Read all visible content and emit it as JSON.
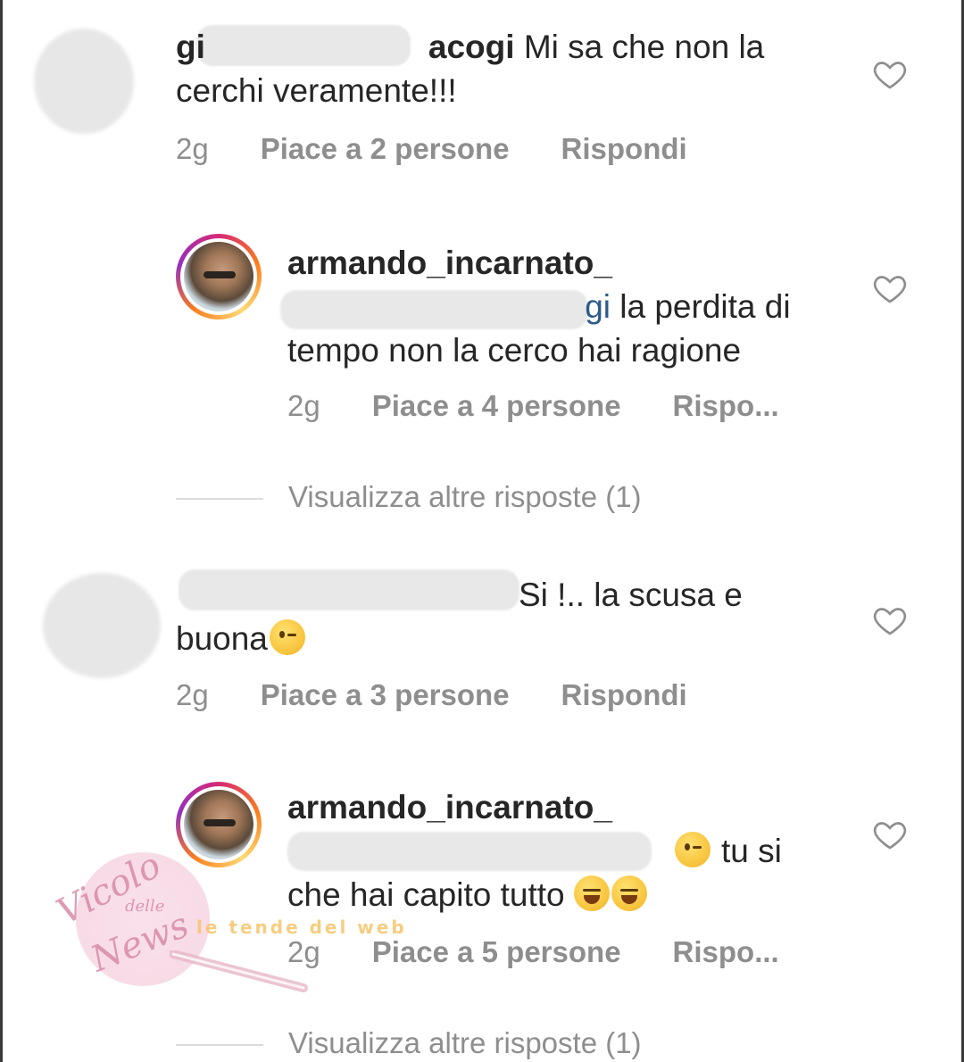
{
  "comments": [
    {
      "username": "gi",
      "username_tail": "acogi",
      "text": "Mi sa che non la cerchi veramente!!!",
      "time": "2g",
      "likes": "Piace a 2 persone",
      "reply": "Rispondi"
    },
    {
      "username": "armando_incarnato_",
      "mention_tail": "gi",
      "text": "la perdita di tempo non la cerco hai ragione",
      "time": "2g",
      "likes": "Piace a 4 persone",
      "reply": "Rispo..."
    },
    {
      "username_tail": "",
      "text_line1": "Si !.. la scusa e",
      "text_line2": "buona",
      "time": "2g",
      "likes": "Piace a 3 persone",
      "reply": "Rispondi"
    },
    {
      "username": "armando_incarnato_",
      "text_line1": "tu si",
      "text_line2": "che hai capito tutto",
      "time": "2g",
      "likes": "Piace a 5 persone",
      "reply": "Rispo..."
    }
  ],
  "view_more": [
    "Visualizza altre risposte (1)",
    "Visualizza altre risposte (1)"
  ],
  "watermark": {
    "brand": "Vicolo",
    "brand_small": "delle",
    "brand_tail": "News",
    "tagline": "le tende del web"
  },
  "icons": {
    "like": "heart-outline-icon",
    "emoji_wink": "winking-face-emoji",
    "emoji_laugh": "tears-of-joy-emoji"
  },
  "colors": {
    "text": "#262626",
    "meta": "#8e8e8e",
    "mention": "#2e5b8a"
  }
}
